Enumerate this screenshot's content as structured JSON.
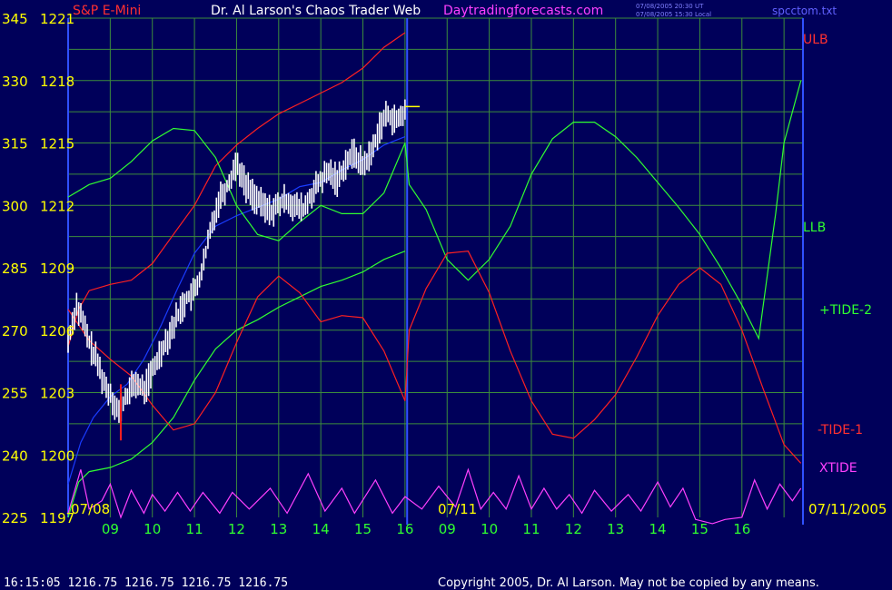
{
  "header": {
    "product": "S&P E-Mini",
    "site": "Dr. Al Larson's Chaos Trader Web",
    "url": "Daytradingforecasts.com",
    "stamp_utc": "07/08/2005 20:30 UT",
    "stamp_local": "07/08/2005 15:30 Local",
    "filename": "spcctom.txt"
  },
  "footer": {
    "quote_line": "16:15:05  1216.75 1216.75 1216.75 1216.75",
    "copyright": "Copyright 2005, Dr. Al Larson.  May not be copied by any means."
  },
  "colors": {
    "background": "#00005a",
    "grid": "#3c8c3c",
    "price": "#ffffff",
    "ulb_red": "#ff2020",
    "llb_green": "#30ff30",
    "blue_line": "#1a3cff",
    "xtide": "#ff40ff",
    "yellow_text": "#ffff00",
    "green_text": "#30ff30",
    "magenta_text": "#ff40ff",
    "red_text": "#ff3030",
    "right_labels": "#ff3030"
  },
  "chart_data": {
    "type": "line",
    "x_axis": {
      "date_left": "07/08",
      "date_mid": "07/11",
      "date_right": "07/11/2005",
      "hour_ticks": [
        "09",
        "10",
        "11",
        "12",
        "13",
        "14",
        "15",
        "16",
        "09",
        "10",
        "11",
        "12",
        "13",
        "14",
        "15",
        "16"
      ]
    },
    "y_axis": {
      "left_scale": [
        "345",
        "330",
        "315",
        "300",
        "285",
        "270",
        "255",
        "240",
        "225"
      ],
      "price_scale": [
        "1221",
        "1218",
        "1215",
        "1212",
        "1209",
        "1206",
        "1203",
        "1200",
        "1197"
      ],
      "price_range": [
        1197,
        1221
      ]
    },
    "right_labels": {
      "ulb": "ULB",
      "llb": "LLB",
      "tide2": "+TIDE-2",
      "tide1": "-TIDE-1",
      "xtide": "XTIDE"
    },
    "series": [
      {
        "name": "ULB",
        "color": "#ff2020",
        "points": [
          [
            0.0,
            1205.2
          ],
          [
            0.25,
            1207.0
          ],
          [
            0.5,
            1207.9
          ],
          [
            1.0,
            1208.2
          ],
          [
            1.5,
            1208.4
          ],
          [
            2.0,
            1209.2
          ],
          [
            2.5,
            1210.6
          ],
          [
            3.0,
            1212.0
          ],
          [
            3.5,
            1213.9
          ],
          [
            4.0,
            1214.9
          ],
          [
            4.5,
            1215.7
          ],
          [
            5.0,
            1216.4
          ],
          [
            5.5,
            1216.9
          ],
          [
            6.0,
            1217.4
          ],
          [
            6.5,
            1217.9
          ],
          [
            7.0,
            1218.6
          ],
          [
            7.5,
            1219.6
          ],
          [
            8.0,
            1220.3
          ]
        ]
      },
      {
        "name": "LLB",
        "color": "#30ff30",
        "points": [
          [
            0.0,
            1197.0
          ],
          [
            0.25,
            1198.7
          ],
          [
            0.5,
            1199.2
          ],
          [
            1.0,
            1199.4
          ],
          [
            1.5,
            1199.8
          ],
          [
            2.0,
            1200.6
          ],
          [
            2.5,
            1201.8
          ],
          [
            3.0,
            1203.6
          ],
          [
            3.5,
            1205.1
          ],
          [
            4.0,
            1206.0
          ],
          [
            4.5,
            1206.5
          ],
          [
            5.0,
            1207.1
          ],
          [
            5.5,
            1207.6
          ],
          [
            6.0,
            1208.1
          ],
          [
            6.5,
            1208.4
          ],
          [
            7.0,
            1208.8
          ],
          [
            7.5,
            1209.4
          ],
          [
            8.0,
            1209.8
          ]
        ]
      },
      {
        "name": "midline",
        "color": "#1a3cff",
        "points": [
          [
            0.0,
            1198.6
          ],
          [
            0.3,
            1200.6
          ],
          [
            0.6,
            1201.8
          ],
          [
            1.0,
            1202.8
          ],
          [
            1.4,
            1203.4
          ],
          [
            1.8,
            1204.6
          ],
          [
            2.2,
            1206.2
          ],
          [
            2.6,
            1208.0
          ],
          [
            3.0,
            1209.7
          ],
          [
            3.5,
            1211.0
          ],
          [
            4.0,
            1211.5
          ],
          [
            4.5,
            1211.9
          ],
          [
            5.0,
            1212.3
          ],
          [
            5.5,
            1212.9
          ],
          [
            6.0,
            1213.1
          ],
          [
            6.5,
            1213.7
          ],
          [
            7.0,
            1214.2
          ],
          [
            7.5,
            1214.9
          ],
          [
            8.0,
            1215.3
          ]
        ]
      },
      {
        "name": "+TIDE-2",
        "color": "#30ff30",
        "points": [
          [
            0.0,
            1212.4
          ],
          [
            0.5,
            1213.0
          ],
          [
            1.0,
            1213.3
          ],
          [
            1.5,
            1214.1
          ],
          [
            2.0,
            1215.1
          ],
          [
            2.5,
            1215.7
          ],
          [
            3.0,
            1215.6
          ],
          [
            3.5,
            1214.3
          ],
          [
            4.0,
            1212.0
          ],
          [
            4.5,
            1210.6
          ],
          [
            5.0,
            1210.3
          ],
          [
            5.5,
            1211.2
          ],
          [
            6.0,
            1212.0
          ],
          [
            6.5,
            1211.6
          ],
          [
            7.0,
            1211.6
          ],
          [
            7.5,
            1212.6
          ],
          [
            8.0,
            1215.0
          ],
          [
            8.1,
            1213.0
          ],
          [
            8.5,
            1211.8
          ],
          [
            9.0,
            1209.4
          ],
          [
            9.5,
            1208.4
          ],
          [
            10.0,
            1209.4
          ],
          [
            10.5,
            1211.0
          ],
          [
            11.0,
            1213.5
          ],
          [
            11.5,
            1215.2
          ],
          [
            12.0,
            1216.0
          ],
          [
            12.5,
            1216.0
          ],
          [
            13.0,
            1215.3
          ],
          [
            13.5,
            1214.3
          ],
          [
            14.0,
            1213.1
          ],
          [
            14.5,
            1211.9
          ],
          [
            15.0,
            1210.6
          ],
          [
            15.5,
            1209.0
          ],
          [
            16.0,
            1207.2
          ],
          [
            16.4,
            1205.6
          ],
          [
            16.8,
            1211.6
          ],
          [
            17.0,
            1215.0
          ],
          [
            17.4,
            1218.0
          ]
        ]
      },
      {
        "name": "-TIDE-1",
        "color": "#ff2020",
        "points": [
          [
            0.0,
            1207.0
          ],
          [
            0.5,
            1205.5
          ],
          [
            1.0,
            1204.6
          ],
          [
            1.5,
            1203.8
          ],
          [
            2.0,
            1202.4
          ],
          [
            2.5,
            1201.2
          ],
          [
            3.0,
            1201.5
          ],
          [
            3.5,
            1203.0
          ],
          [
            4.0,
            1205.4
          ],
          [
            4.5,
            1207.6
          ],
          [
            5.0,
            1208.6
          ],
          [
            5.5,
            1207.8
          ],
          [
            6.0,
            1206.4
          ],
          [
            6.5,
            1206.7
          ],
          [
            7.0,
            1206.6
          ],
          [
            7.5,
            1205.0
          ],
          [
            8.0,
            1202.6
          ],
          [
            8.1,
            1206.0
          ],
          [
            8.5,
            1208.0
          ],
          [
            9.0,
            1209.7
          ],
          [
            9.5,
            1209.8
          ],
          [
            10.0,
            1207.8
          ],
          [
            10.5,
            1205.0
          ],
          [
            11.0,
            1202.6
          ],
          [
            11.5,
            1201.0
          ],
          [
            12.0,
            1200.8
          ],
          [
            12.5,
            1201.7
          ],
          [
            13.0,
            1202.9
          ],
          [
            13.5,
            1204.7
          ],
          [
            14.0,
            1206.7
          ],
          [
            14.5,
            1208.2
          ],
          [
            15.0,
            1209.0
          ],
          [
            15.5,
            1208.2
          ],
          [
            16.0,
            1206.0
          ],
          [
            16.5,
            1203.2
          ],
          [
            17.0,
            1200.5
          ],
          [
            17.4,
            1199.6
          ]
        ]
      },
      {
        "name": "XTIDE",
        "color": "#ff40ff",
        "points": [
          [
            0.0,
            1197.2
          ],
          [
            0.3,
            1199.3
          ],
          [
            0.5,
            1197.4
          ],
          [
            0.8,
            1197.8
          ],
          [
            1.0,
            1198.6
          ],
          [
            1.25,
            1197.0
          ],
          [
            1.5,
            1198.3
          ],
          [
            1.8,
            1197.2
          ],
          [
            2.0,
            1198.1
          ],
          [
            2.3,
            1197.3
          ],
          [
            2.6,
            1198.2
          ],
          [
            2.9,
            1197.3
          ],
          [
            3.2,
            1198.2
          ],
          [
            3.6,
            1197.2
          ],
          [
            3.9,
            1198.2
          ],
          [
            4.3,
            1197.4
          ],
          [
            4.8,
            1198.4
          ],
          [
            5.2,
            1197.2
          ],
          [
            5.7,
            1199.1
          ],
          [
            6.1,
            1197.3
          ],
          [
            6.5,
            1198.4
          ],
          [
            6.8,
            1197.2
          ],
          [
            7.3,
            1198.8
          ],
          [
            7.7,
            1197.2
          ],
          [
            8.0,
            1198.0
          ],
          [
            8.4,
            1197.4
          ],
          [
            8.8,
            1198.5
          ],
          [
            9.2,
            1197.5
          ],
          [
            9.5,
            1199.3
          ],
          [
            9.8,
            1197.4
          ],
          [
            10.1,
            1198.2
          ],
          [
            10.4,
            1197.4
          ],
          [
            10.7,
            1199.0
          ],
          [
            11.0,
            1197.4
          ],
          [
            11.3,
            1198.4
          ],
          [
            11.6,
            1197.4
          ],
          [
            11.9,
            1198.1
          ],
          [
            12.2,
            1197.2
          ],
          [
            12.5,
            1198.3
          ],
          [
            12.9,
            1197.3
          ],
          [
            13.3,
            1198.1
          ],
          [
            13.6,
            1197.3
          ],
          [
            14.0,
            1198.7
          ],
          [
            14.3,
            1197.5
          ],
          [
            14.6,
            1198.4
          ],
          [
            14.9,
            1196.9
          ],
          [
            15.3,
            1196.7
          ],
          [
            15.6,
            1196.9
          ],
          [
            16.0,
            1197.0
          ],
          [
            16.3,
            1198.8
          ],
          [
            16.6,
            1197.4
          ],
          [
            16.9,
            1198.6
          ],
          [
            17.2,
            1197.8
          ],
          [
            17.4,
            1198.4
          ]
        ]
      }
    ],
    "price_bars": [
      {
        "x_start": 0.0,
        "x_end": 8.0,
        "count": 160
      },
      [
        [
          0.0,
          1205.5
        ],
        [
          0.2,
          1207.2
        ],
        [
          0.35,
          1206.4
        ],
        [
          0.5,
          1205.4
        ],
        [
          0.7,
          1204.4
        ],
        [
          0.9,
          1203.2
        ],
        [
          1.0,
          1203.0
        ],
        [
          1.2,
          1202.0
        ],
        [
          1.4,
          1202.9
        ],
        [
          1.6,
          1203.5
        ],
        [
          1.8,
          1203.1
        ],
        [
          2.0,
          1204.0
        ],
        [
          2.2,
          1205.0
        ],
        [
          2.4,
          1205.8
        ],
        [
          2.6,
          1206.7
        ],
        [
          2.8,
          1207.5
        ],
        [
          3.0,
          1207.8
        ],
        [
          3.2,
          1209.0
        ],
        [
          3.4,
          1211.0
        ],
        [
          3.6,
          1212.4
        ],
        [
          3.8,
          1213.0
        ],
        [
          4.0,
          1214.1
        ],
        [
          4.2,
          1213.0
        ],
        [
          4.4,
          1212.5
        ],
        [
          4.6,
          1212.0
        ],
        [
          4.8,
          1211.7
        ],
        [
          5.0,
          1212.0
        ],
        [
          5.2,
          1212.3
        ],
        [
          5.4,
          1211.9
        ],
        [
          5.6,
          1211.8
        ],
        [
          5.8,
          1212.6
        ],
        [
          6.0,
          1213.2
        ],
        [
          6.2,
          1213.6
        ],
        [
          6.4,
          1213.2
        ],
        [
          6.6,
          1214.1
        ],
        [
          6.8,
          1214.5
        ],
        [
          7.0,
          1213.9
        ],
        [
          7.2,
          1214.5
        ],
        [
          7.4,
          1215.8
        ],
        [
          7.6,
          1216.4
        ],
        [
          7.8,
          1216.0
        ],
        [
          8.0,
          1216.5
        ]
      ]
    ],
    "last_price": 1216.75
  }
}
